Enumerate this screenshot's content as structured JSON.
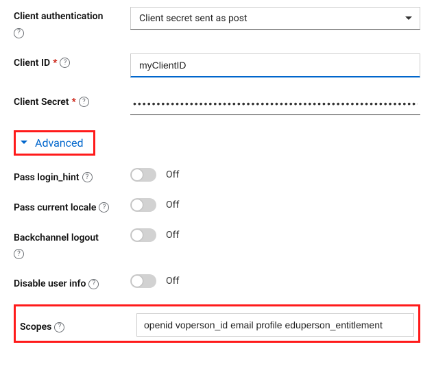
{
  "client_auth": {
    "label": "Client authentication",
    "value": "Client secret sent as post"
  },
  "client_id": {
    "label": "Client ID",
    "required_marker": "*",
    "value": "myClientID"
  },
  "client_secret": {
    "label": "Client Secret",
    "required_marker": "*",
    "value": "•••••••••••••••••••••••••••••••••••••••••••••••••••••••••••••••••••"
  },
  "advanced": {
    "label": "Advanced"
  },
  "pass_login_hint": {
    "label": "Pass login_hint",
    "state": "Off"
  },
  "pass_current_locale": {
    "label": "Pass current locale",
    "state": "Off"
  },
  "backchannel_logout": {
    "label": "Backchannel logout",
    "state": "Off"
  },
  "disable_user_info": {
    "label": "Disable user info",
    "state": "Off"
  },
  "scopes": {
    "label": "Scopes",
    "value": "openid voperson_id email profile eduperson_entitlement"
  }
}
